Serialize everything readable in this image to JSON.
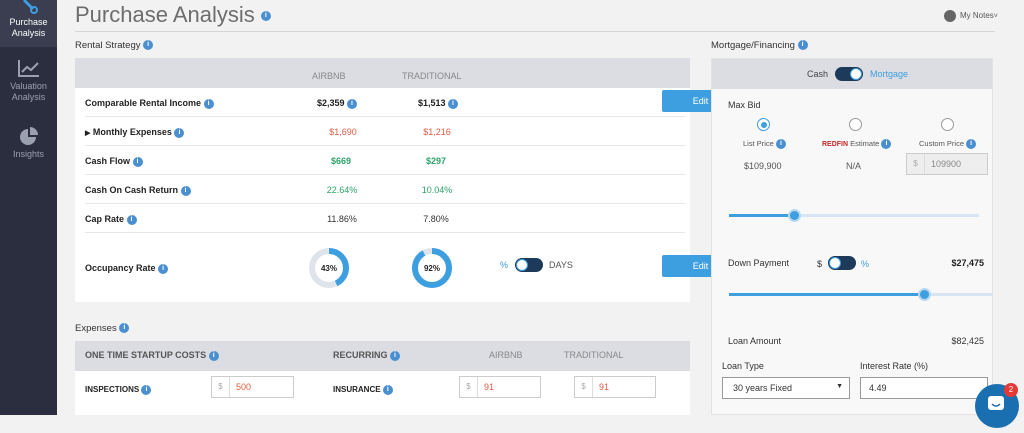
{
  "sidebar": {
    "items": [
      {
        "label": "Purchase Analysis",
        "icon": "wrench-icon"
      },
      {
        "label": "Valuation Analysis",
        "icon": "line-chart-icon"
      },
      {
        "label": "Insights",
        "icon": "pie-chart-icon"
      }
    ]
  },
  "header": {
    "title": "Purchase Analysis",
    "my_notes": "My Notes"
  },
  "rental": {
    "section_label": "Rental Strategy",
    "col_airbnb": "AIRBNB",
    "col_traditional": "TRADITIONAL",
    "rows": [
      {
        "label": "Comparable Rental Income",
        "airbnb": "$2,359",
        "traditional": "$1,513"
      },
      {
        "label": "Monthly Expenses",
        "airbnb": "$1,690",
        "traditional": "$1,216"
      },
      {
        "label": "Cash Flow",
        "airbnb": "$669",
        "traditional": "$297"
      },
      {
        "label": "Cash On Cash Return",
        "airbnb": "22.64%",
        "traditional": "10.04%"
      },
      {
        "label": "Cap Rate",
        "airbnb": "11.86%",
        "traditional": "7.80%"
      }
    ],
    "occupancy": {
      "label": "Occupancy Rate",
      "airbnb": "43%",
      "traditional": "92%",
      "airbnb_level": 0.43,
      "traditional_level": 0.92,
      "unit_percent": "%",
      "unit_days": "DAYS"
    },
    "edit_label": "Edit",
    "accent": "#3d9ee0"
  },
  "expenses": {
    "section_label": "Expenses",
    "startup_header": "ONE TIME STARTUP COSTS",
    "recurring_header": "RECURRING",
    "col_airbnb": "AIRBNB",
    "col_traditional": "TRADITIONAL",
    "currency": "$",
    "rows": [
      {
        "startup_label": "INSPECTIONS",
        "startup_value": "500",
        "recurring_label": "INSURANCE",
        "airbnb": "91",
        "traditional": "91"
      }
    ]
  },
  "mortgage": {
    "section_label": "Mortgage/Financing",
    "toggle_cash": "Cash",
    "toggle_mortgage": "Mortgage",
    "max_bid_label": "Max Bid",
    "options": [
      {
        "label": "List Price",
        "value": "$109,900"
      },
      {
        "label": "Estimate",
        "brand": "REDFIN",
        "value": "N/A"
      },
      {
        "label": "Custom Price",
        "prefix": "$",
        "value": "109900"
      }
    ],
    "bid_slider_level": 0.26,
    "down_payment_label": "Down Payment",
    "down_payment_dollar": "$",
    "down_payment_percent": "%",
    "down_payment_value": "$27,475",
    "down_slider_level": 0.74,
    "loan_amount_label": "Loan Amount",
    "loan_amount_value": "$82,425",
    "loan_type_label": "Loan Type",
    "loan_type_value": "30 years Fixed",
    "interest_label": "Interest Rate (%)",
    "interest_value": "4.49"
  },
  "chat": {
    "badge": "2"
  }
}
